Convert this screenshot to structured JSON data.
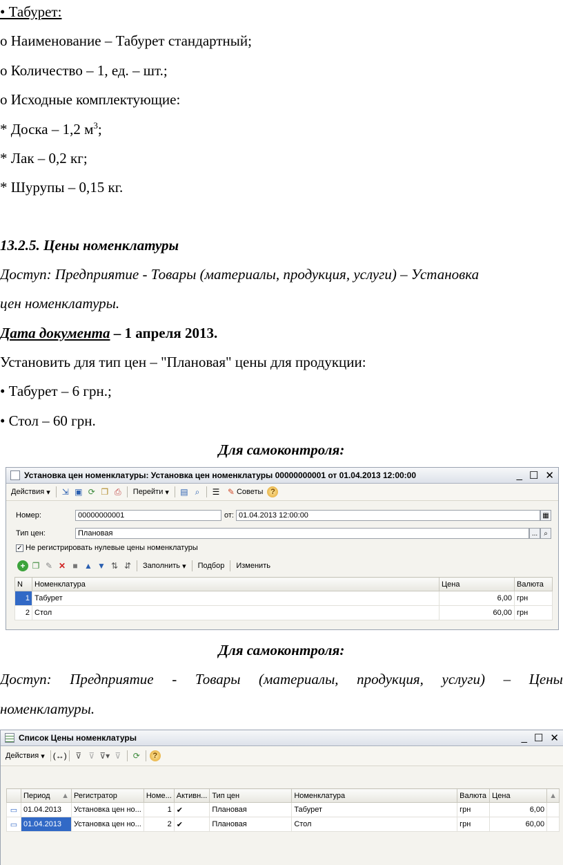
{
  "lines": {
    "l1": "• Табурет:",
    "l2": "o Наименование – Табурет стандартный;",
    "l3": "o Количество – 1, ед. – шт.;",
    "l4": "o Исходные комплектующие:",
    "l5_pre": "* Доска – 1,2 м",
    "l5_sup": "3",
    "l5_post": ";",
    "l6": "* Лак – 0,2 кг;",
    "l7": "* Шурупы – 0,15 кг.",
    "heading": "13.2.5. Цены номенклатуры",
    "access1_a": "Доступ: Предприятие - Товары (материалы, продукция, услуги) – Установка",
    "access1_b": "цен номенклатуры.",
    "date_label": "Дата документа",
    "date_value": " – 1 апреля 2013.",
    "instruction": "Установить для тип цен – \"Плановая\" цены для продукции:",
    "item1": "•  Табурет – 6 грн.;",
    "item2": "• Стол – 60 грн.",
    "selfcheck1": "Для самоконтроля:",
    "selfcheck2": "Для самоконтроля:",
    "access2_words": [
      "Доступ:",
      "Предприятие",
      "-",
      "Товары",
      "(материалы,",
      "продукция,",
      "услуги)",
      "–",
      "Цены"
    ],
    "access2_b": "номенклатуры."
  },
  "win1": {
    "title": "Установка цен номенклатуры: Установка цен номенклатуры 00000000001 от 01.04.2013 12:00:00",
    "toolbar": {
      "actions": "Действия",
      "goto": "Перейти",
      "tips": "Советы"
    },
    "number_label": "Номер:",
    "number_value": "00000000001",
    "from_label": "от:",
    "from_value": "01.04.2013 12:00:00",
    "price_type_label": "Тип цен:",
    "price_type_value": "Плановая",
    "checkbox_label": "Не регистрировать нулевые цены номенклатуры",
    "table_toolbar": {
      "fill": "Заполнить",
      "select": "Подбор",
      "change": "Изменить"
    },
    "columns": {
      "n": "N",
      "item": "Номенклатура",
      "price": "Цена",
      "currency": "Валюта"
    },
    "rows": [
      {
        "n": "1",
        "item": "Табурет",
        "price": "6,00",
        "currency": "грн"
      },
      {
        "n": "2",
        "item": "Стол",
        "price": "60,00",
        "currency": "грн"
      }
    ]
  },
  "win2": {
    "title": "Список Цены номенклатуры",
    "toolbar": {
      "actions": "Действия"
    },
    "columns": {
      "period": "Период",
      "registrar": "Регистратор",
      "num": "Номе...",
      "active": "Активн...",
      "price_type": "Тип цен",
      "item": "Номенклатура",
      "currency": "Валюта",
      "price": "Цена"
    },
    "rows": [
      {
        "period": "01.04.2013",
        "registrar": "Установка цен но...",
        "num": "1",
        "active": "✔",
        "price_type": "Плановая",
        "item": "Табурет",
        "currency": "грн",
        "price": "6,00"
      },
      {
        "period": "01.04.2013",
        "registrar": "Установка цен но...",
        "num": "2",
        "active": "✔",
        "price_type": "Плановая",
        "item": "Стол",
        "currency": "грн",
        "price": "60,00"
      }
    ]
  }
}
